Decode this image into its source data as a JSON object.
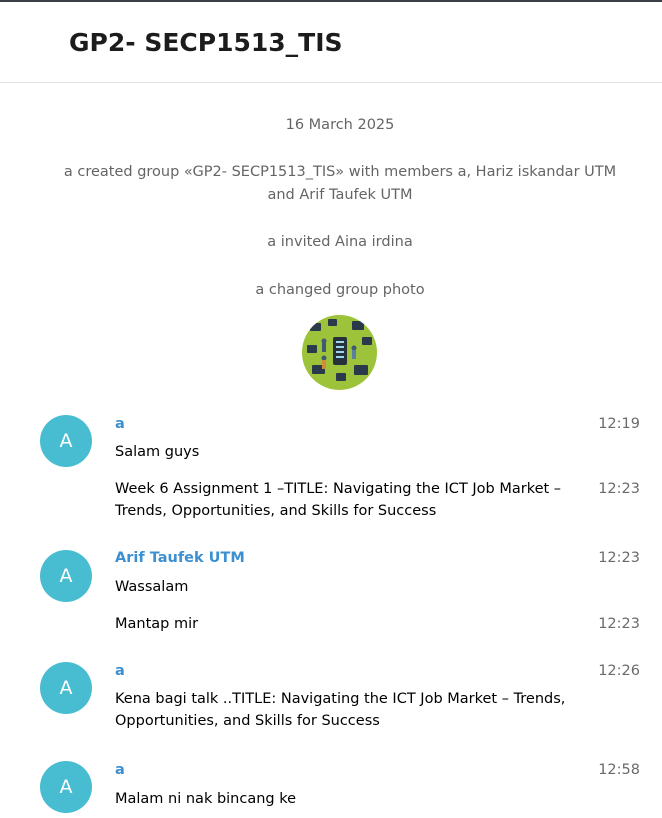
{
  "header": {
    "title": "GP2- SECP1513_TIS"
  },
  "service_messages": {
    "date": "16 March 2025",
    "created": "a created group «GP2- SECP1513_TIS» with members a, Hariz iskandar UTM and Arif Taufek UTM",
    "invited": "a invited Aina irdina",
    "photo_changed": "a changed group photo"
  },
  "messages": [
    {
      "avatar": "A",
      "from": "a",
      "time": "12:19",
      "text": "Salam guys"
    },
    {
      "time": "12:23",
      "text": "Week 6 Assignment 1 –TITLE: Navigating the ICT Job Market – Trends, Opportunities, and Skills for Success"
    },
    {
      "avatar": "A",
      "from": "Arif Taufek UTM",
      "time": "12:23",
      "text": "Wassalam"
    },
    {
      "time": "12:23",
      "text": "Mantap mir"
    },
    {
      "avatar": "A",
      "from": "a",
      "time": "12:26",
      "text": "Kena bagi talk ..TITLE: Navigating the ICT Job Market – Trends, Opportunities, and Skills for Success"
    },
    {
      "avatar": "A",
      "from": "a",
      "time": "12:58",
      "text": "Malam ni nak bincang ke"
    }
  ],
  "colors": {
    "avatar": "#48bdd1",
    "sender_name": "#3c8fd0",
    "service_text": "#656565"
  }
}
